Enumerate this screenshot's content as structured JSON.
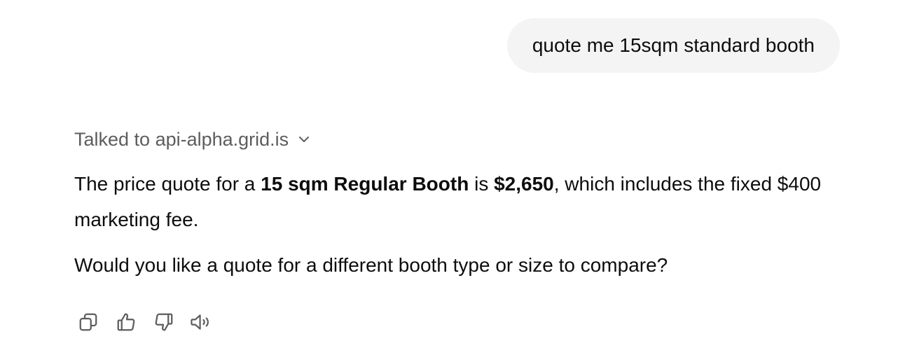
{
  "user_message": {
    "text": "quote me 15sqm standard booth"
  },
  "assistant": {
    "tool_call_label": "Talked to api-alpha.grid.is",
    "paragraph1": {
      "t1": "The price quote for a ",
      "b1": "15 sqm Regular Booth",
      "t2": " is ",
      "b2": "$2,650",
      "t3": ", which includes the fixed $400 marketing fee."
    },
    "paragraph2": "Would you like a quote for a different booth type or size to compare?"
  },
  "actions": [
    {
      "icon": "copy-icon"
    },
    {
      "icon": "thumbs-up-icon"
    },
    {
      "icon": "thumbs-down-icon"
    },
    {
      "icon": "read-aloud-icon"
    }
  ]
}
